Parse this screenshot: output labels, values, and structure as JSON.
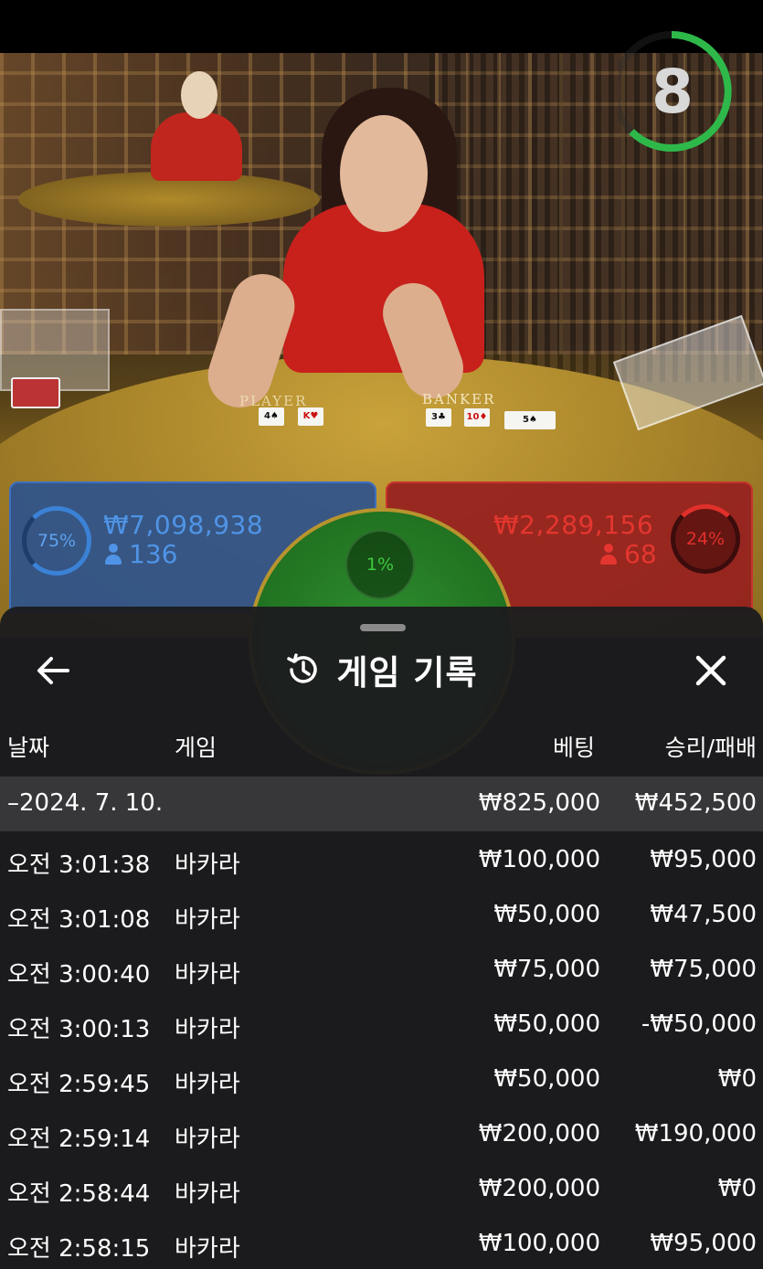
{
  "timer": {
    "value": "8"
  },
  "table": {
    "banker_label": "BANKER",
    "player_label": "PLAYER"
  },
  "cards": {
    "player": [
      "4♠",
      "K♥"
    ],
    "banker": [
      "3♣",
      "10♦",
      "5♠"
    ]
  },
  "bets": {
    "player": {
      "percent": "75%",
      "amount": "₩7,098,938",
      "users": "136",
      "color": "#4f94e6"
    },
    "banker": {
      "percent": "24%",
      "amount": "₩2,289,156",
      "users": "68",
      "color": "#e4362f"
    },
    "tie": {
      "percent": "1%",
      "color": "#3fc93f"
    }
  },
  "history": {
    "title": "게임 기록",
    "columns": {
      "date": "날짜",
      "game": "게임",
      "bet": "베팅",
      "win_loss": "승리/패배"
    },
    "summary": {
      "date": "–2024. 7. 10.",
      "bet": "₩825,000",
      "win_loss": "₩452,500"
    },
    "rows": [
      {
        "time": "오전 3:01:38",
        "game": "바카라",
        "bet": "₩100,000",
        "win_loss": "₩95,000"
      },
      {
        "time": "오전 3:01:08",
        "game": "바카라",
        "bet": "₩50,000",
        "win_loss": "₩47,500"
      },
      {
        "time": "오전 3:00:40",
        "game": "바카라",
        "bet": "₩75,000",
        "win_loss": "₩75,000"
      },
      {
        "time": "오전 3:00:13",
        "game": "바카라",
        "bet": "₩50,000",
        "win_loss": "-₩50,000"
      },
      {
        "time": "오전 2:59:45",
        "game": "바카라",
        "bet": "₩50,000",
        "win_loss": "₩0"
      },
      {
        "time": "오전 2:59:14",
        "game": "바카라",
        "bet": "₩200,000",
        "win_loss": "₩190,000"
      },
      {
        "time": "오전 2:58:44",
        "game": "바카라",
        "bet": "₩200,000",
        "win_loss": "₩0"
      },
      {
        "time": "오전 2:58:15",
        "game": "바카라",
        "bet": "₩100,000",
        "win_loss": "₩95,000"
      }
    ]
  },
  "icons": {
    "back": "arrow-left-icon",
    "close": "close-icon",
    "history": "history-icon",
    "users": "user-icon"
  }
}
